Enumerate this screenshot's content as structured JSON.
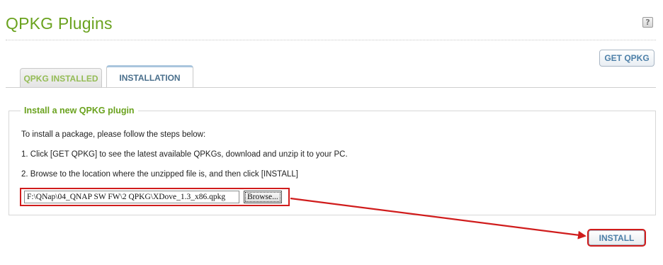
{
  "page": {
    "title": "QPKG Plugins"
  },
  "help": {
    "glyph": "?"
  },
  "toolbar": {
    "get_qpkg_label": "GET QPKG"
  },
  "tabs": [
    {
      "label": "QPKG INSTALLED",
      "active": false
    },
    {
      "label": "INSTALLATION",
      "active": true
    }
  ],
  "install_section": {
    "legend": "Install a new QPKG plugin",
    "intro": "To install a package, please follow the steps below:",
    "step1": "1. Click [GET QPKG] to see the latest available QPKGs, download and unzip it to your PC.",
    "step2": "2. Browse to the location where the unzipped file is, and then click [INSTALL]",
    "file_path": "F:\\QNap\\04_QNAP SW FW\\2 QPKG\\XDove_1.3_x86.qpkg",
    "browse_label": "Browse...",
    "install_label": "INSTALL"
  },
  "colors": {
    "title_green": "#6aa21e",
    "button_blue": "#4c7fa8",
    "highlight_red": "#d01c1c"
  }
}
